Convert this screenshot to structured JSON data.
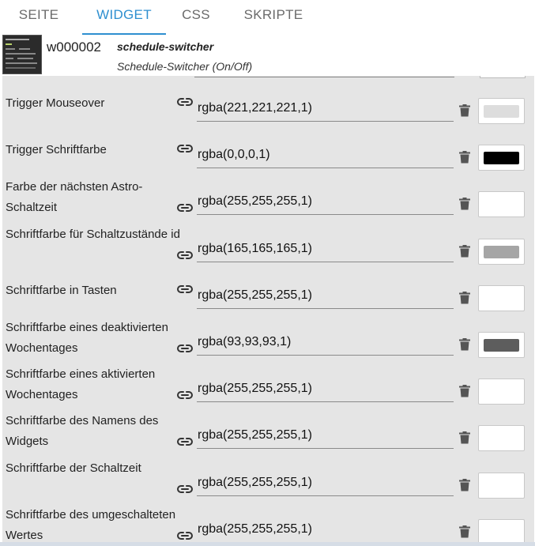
{
  "tabs": [
    {
      "label": "SEITE",
      "active": false
    },
    {
      "label": "WIDGET",
      "active": true
    },
    {
      "label": "CSS",
      "active": false
    },
    {
      "label": "SKRIPTE",
      "active": false
    }
  ],
  "widget": {
    "id": "w000002",
    "type": "schedule-switcher",
    "description": "Schedule-Switcher (On/Off)"
  },
  "accent_color": "#2e8fd0",
  "icons": {
    "link": "link-icon",
    "delete": "trash-icon"
  },
  "properties": [
    {
      "label": "Trigger Mouseover",
      "value": "rgba(221,221,221,1)",
      "color": "#dddddd"
    },
    {
      "label": "Trigger Schriftfarbe",
      "value": "rgba(0,0,0,1)",
      "color": "#000000"
    },
    {
      "label": "Farbe der nächsten Astro-Schaltzeit",
      "value": "rgba(255,255,255,1)",
      "color": "#ffffff"
    },
    {
      "label": "Schriftfarbe für Schaltzustände id",
      "value": "rgba(165,165,165,1)",
      "color": "#a5a5a5"
    },
    {
      "label": "Schriftfarbe in Tasten",
      "value": "rgba(255,255,255,1)",
      "color": "#ffffff"
    },
    {
      "label": "Schriftfarbe eines deaktivierten Wochentages",
      "value": "rgba(93,93,93,1)",
      "color": "#5d5d5d"
    },
    {
      "label": "Schriftfarbe eines aktivierten Wochentages",
      "value": "rgba(255,255,255,1)",
      "color": "#ffffff"
    },
    {
      "label": "Schriftfarbe des Namens des Widgets",
      "value": "rgba(255,255,255,1)",
      "color": "#ffffff"
    },
    {
      "label": "Schriftfarbe der Schaltzeit",
      "value": "rgba(255,255,255,1)",
      "color": "#ffffff"
    },
    {
      "label": "Schriftfarbe des umgeschalteten Wertes",
      "value": "rgba(255,255,255,1)",
      "color": "#ffffff"
    }
  ]
}
